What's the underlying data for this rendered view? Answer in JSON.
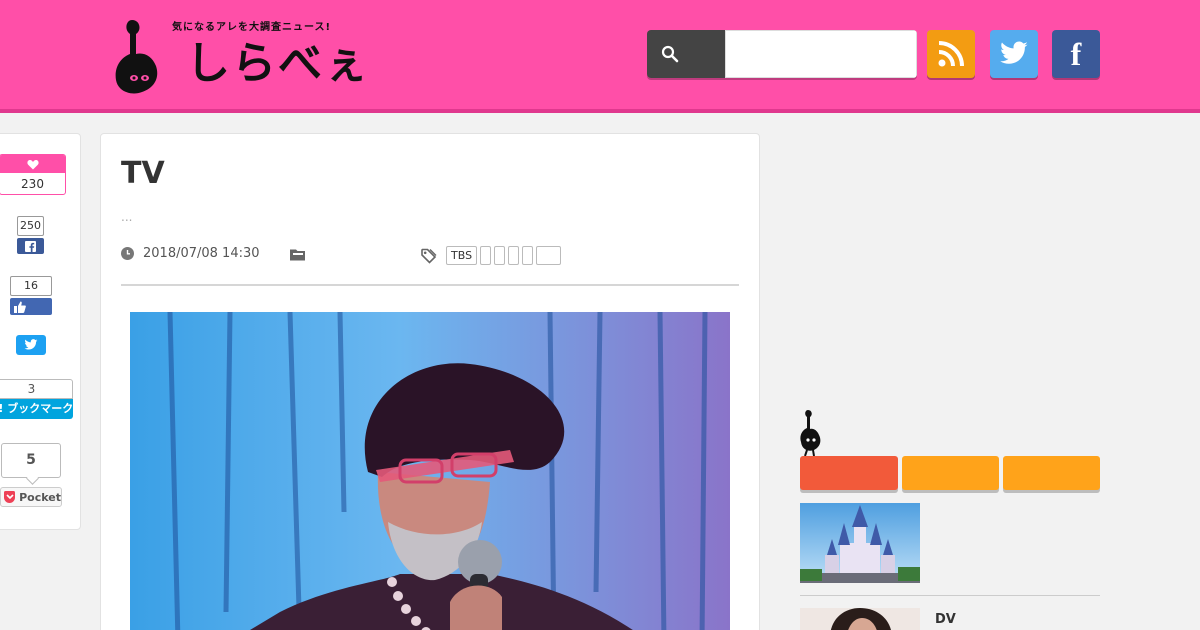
{
  "header": {
    "tagline": "気になるアレを大調査ニュース!",
    "logo_text": "しらべぇ",
    "search": {
      "value": "",
      "placeholder": ""
    },
    "accent_color": "#ff4fa8",
    "social": [
      "rss-icon",
      "twitter-icon",
      "facebook-icon"
    ],
    "facebook_letter": "f"
  },
  "share": {
    "like_count": "230",
    "facebook_count": "250",
    "facebook_like_count": "16",
    "hatena_count": "3",
    "hatena_label": "B! ブックマーク",
    "pocket_count": "5",
    "pocket_label": "Pocket"
  },
  "article": {
    "title": "TV",
    "lead": "...",
    "date": "2018/07/08 14:30",
    "tags": [
      "TBS",
      "",
      "",
      "",
      "",
      ""
    ]
  },
  "sidebar": {
    "tab_colors": [
      "#f25a3a",
      "#ffa31a",
      "#ffa31a"
    ],
    "item2_title": "DV"
  }
}
